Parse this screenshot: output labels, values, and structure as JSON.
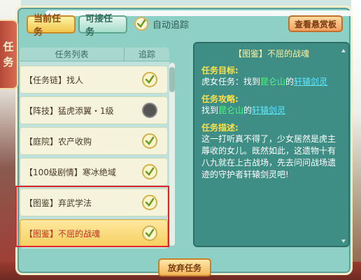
{
  "side_tab": {
    "chars": [
      "任",
      "务"
    ]
  },
  "tabs": [
    {
      "label": "当前任务",
      "active": true
    },
    {
      "label": "可接任务",
      "active": false
    }
  ],
  "auto_track": {
    "label": "自动追踪",
    "checked": true
  },
  "bounty_button": {
    "label": "查看悬赏板"
  },
  "quest_list": {
    "header_name": "任务列表",
    "header_track": "追踪",
    "items": [
      {
        "label": "【任务链】找人",
        "tracked": true
      },
      {
        "label": "【阵技】猛虎添翼・1级",
        "tracked": false
      },
      {
        "label": "【庭院】农产收购",
        "tracked": true
      },
      {
        "label": "【100级剧情】寒冰绝域",
        "tracked": true
      },
      {
        "label": "【图鉴】弃武学法",
        "tracked": true
      },
      {
        "label": "【图鉴】不屈的战魂",
        "tracked": true,
        "selected": true
      }
    ]
  },
  "detail": {
    "title": "【图鉴】不屈的战魂",
    "goal_title": "任务目标:",
    "goal_prefix": "虎女任务：找到",
    "goal_place": "昆仑山",
    "goal_mid": "的",
    "goal_target": "轩辕剑灵",
    "strategy_title": "任务攻略:",
    "strategy_prefix": "找到",
    "strategy_place": "昆仑山",
    "strategy_mid": "的",
    "strategy_target": "轩辕剑灵",
    "desc_title": "任务描述:",
    "desc_text": "这一打听真不得了，少女居然是虎主蓐收的女儿。既然如此，这遗物十有八九就在上古战场，先去问问战场遗迹的守护者轩辕剑灵吧!"
  },
  "abandon_button": {
    "label": "放弃任务"
  },
  "colors": {
    "panel_bg": "#8fd0c6",
    "detail_bg": "#3f8e86",
    "highlight_place": "#4aff7a",
    "highlight_target": "#5fe8ff",
    "selection_box": "#e0262a"
  }
}
